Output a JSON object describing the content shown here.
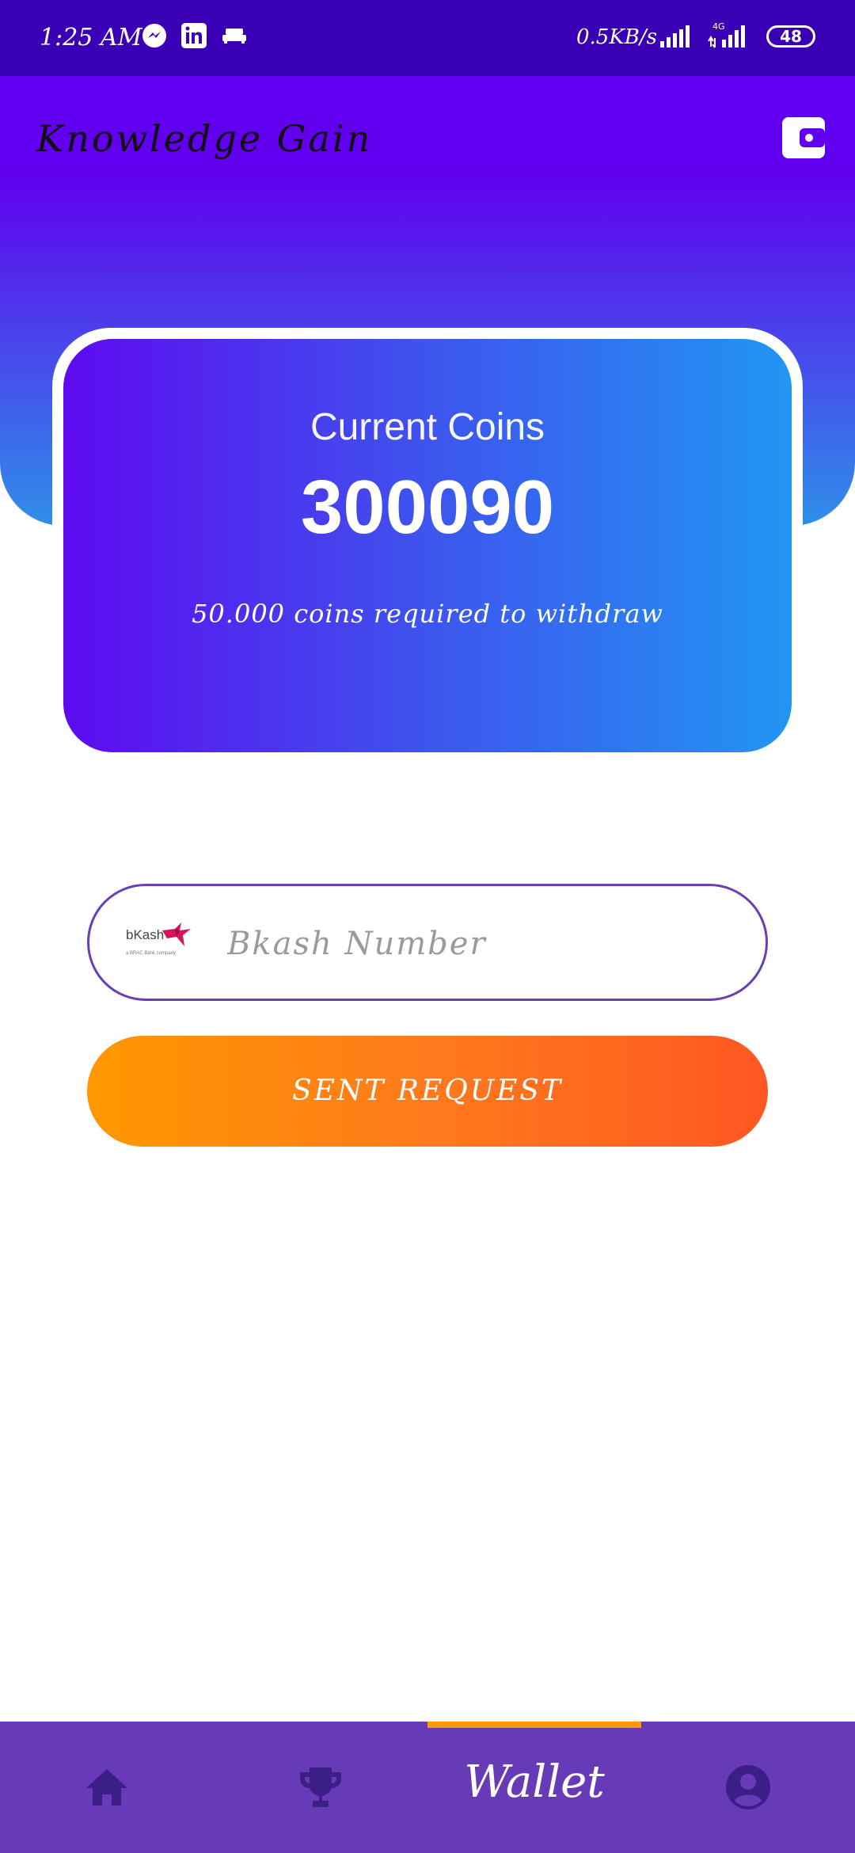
{
  "status_bar": {
    "time": "1:25 AM",
    "net_speed": "0.5KB/s",
    "network_type": "4G",
    "battery": "48",
    "icons": [
      "messenger-icon",
      "linkedin-icon",
      "sofa-icon",
      "signal-icon",
      "signal-4g-icon",
      "battery-icon"
    ]
  },
  "header": {
    "title": "Knowledge Gain",
    "wallet_icon": "wallet-icon"
  },
  "coins_card": {
    "label": "Current Coins",
    "value": "300090",
    "note": "50.000 coins required to withdraw"
  },
  "bkash": {
    "logo_text": "bKash",
    "logo_sub": "a BRAC Bank company",
    "placeholder": "Bkash Number",
    "value": ""
  },
  "send_button": {
    "label": "SENT REQUEST"
  },
  "bottom_nav": {
    "items": [
      {
        "icon": "home-icon",
        "label": ""
      },
      {
        "icon": "trophy-icon",
        "label": ""
      },
      {
        "icon": "wallet-icon",
        "label": "Wallet",
        "active": true
      },
      {
        "icon": "account-icon",
        "label": ""
      }
    ]
  },
  "colors": {
    "status_bar": "#3a00b5",
    "primary": "#6100ee",
    "accent_blue": "#2196f3",
    "button_orange": "#ff9800",
    "button_red": "#ff5722",
    "nav_bg": "#673ab7",
    "nav_icon": "#3c1f86"
  }
}
